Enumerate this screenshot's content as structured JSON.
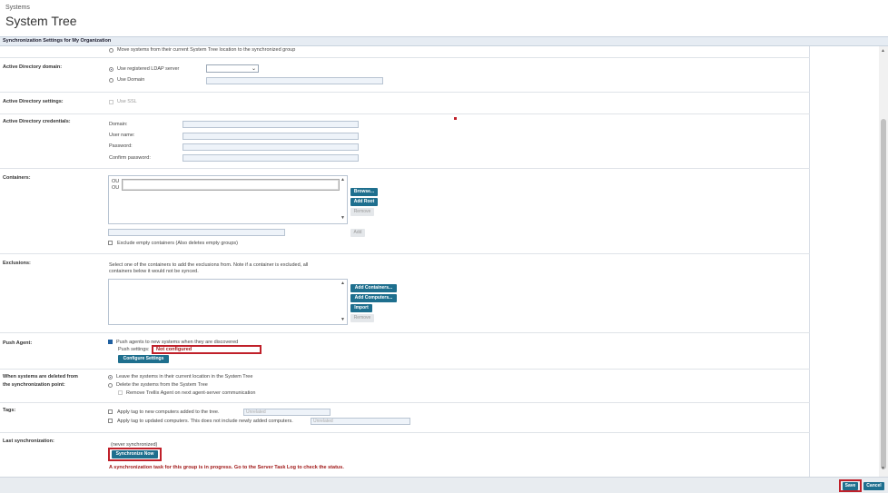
{
  "header": {
    "breadcrumb": "Systems",
    "title": "System Tree"
  },
  "section_title": "Synchronization Settings for My Organization",
  "move_option": "Move systems from their current System Tree location to the synchronized group",
  "ad_domain": {
    "label": "Active Directory domain:",
    "use_ldap_label": "Use registered LDAP server",
    "use_domain_label": "Use Domain",
    "ldap_selected": "",
    "domain_value": ""
  },
  "ad_settings": {
    "label": "Active Directory settings:",
    "use_ssl_label": "Use SSL"
  },
  "ad_credentials": {
    "label": "Active Directory credentials:",
    "domain_label": "Domain:",
    "username_label": "User name:",
    "password_label": "Password:",
    "confirm_label": "Confirm password:"
  },
  "containers": {
    "label": "Containers:",
    "items": [
      "OU",
      "OU"
    ],
    "browse": "Browse...",
    "add_root": "Add Root",
    "remove": "Remove",
    "add": "Add",
    "exclude_label": "Exclude empty containers (Also deletes empty groups)"
  },
  "exclusions": {
    "label": "Exclusions:",
    "desc1": "Select one of the containers to add the exclusions from. Note if a container is excluded, all",
    "desc2": "containers below it would not be synced.",
    "add_containers": "Add Containers...",
    "add_computers": "Add Computers...",
    "import": "Import",
    "remove": "Remove"
  },
  "push_agent": {
    "label": "Push Agent:",
    "checkbox_label": "Push agents to new systems when they are discovered",
    "settings_label": "Push settings:",
    "settings_value": "Not configured",
    "configure": "Configure Settings"
  },
  "deleted": {
    "label1": "When systems are deleted from",
    "label2": "the synchronization point:",
    "leave": "Leave the systems in their current location in the System Tree",
    "delete": "Delete the systems from the System Tree",
    "remove_agent": "Remove Trellix Agent on next agent-server communication"
  },
  "tags": {
    "label": "Tags:",
    "new_label": "Apply tag to new computers added to the tree.",
    "new_placeholder": "Unrelated",
    "updated_label": "Apply tag to updated computers. This does not include newly added computers.",
    "updated_placeholder": "Unrelated"
  },
  "last_sync": {
    "label": "Last synchronization:",
    "status": "(never synchronized)",
    "sync_now": "Synchronize Now",
    "warning": "A synchronization task for this group is in progress. Go to the Server Task Log to check the status."
  },
  "footer": {
    "save": "Save",
    "cancel": "Cancel"
  },
  "colors": {
    "primary_button": "#1e6f8e",
    "highlight": "#c0202a",
    "warning": "#a01818"
  }
}
